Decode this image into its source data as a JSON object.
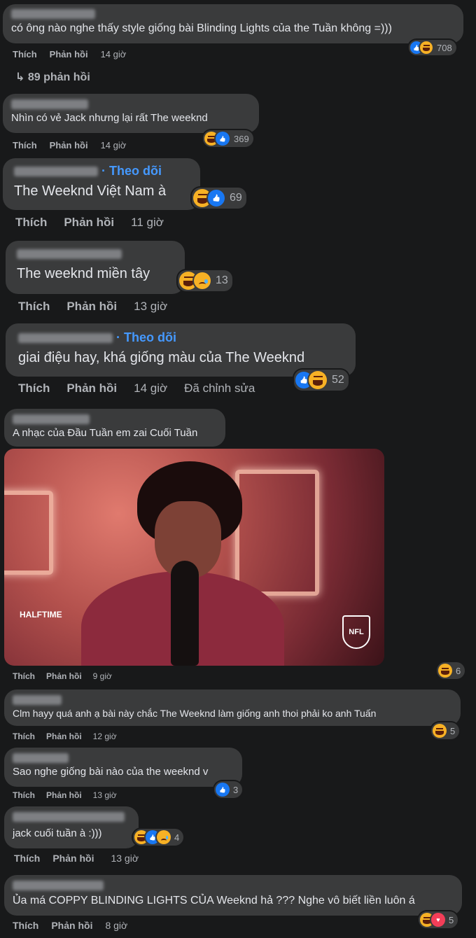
{
  "actions": {
    "like": "Thích",
    "reply": "Phản hồi",
    "edited": "Đã chỉnh sửa"
  },
  "follow_label": "· Theo dõi",
  "comments": [
    {
      "text": "có ông nào nghe thấy style giống bài Blinding Lights của the Tuần không =)))",
      "time": "14 giờ",
      "react_count": "708",
      "replies_label": "89 phản hồi"
    },
    {
      "text": "Nhìn có vẻ Jack nhưng lại rất The weeknd",
      "time": "14 giờ",
      "react_count": "369"
    },
    {
      "text": "The Weeknd Việt Nam à",
      "time": "11 giờ",
      "react_count": "69"
    },
    {
      "text": "The weeknd miền tây",
      "time": "13 giờ",
      "react_count": "13"
    },
    {
      "text": "giai điệu hay, khá giống màu của The Weeknd",
      "time": "14 giờ",
      "react_count": "52"
    },
    {
      "text": "A nhạc của Đầu Tuần em zai Cuối Tuần",
      "time": "9 giờ",
      "react_count": "6"
    },
    {
      "text": "Clm hayy quá anh ạ bài này chắc The Weeknd làm giống anh thoi phải ko anh Tuấn",
      "time": "12 giờ",
      "react_count": "5"
    },
    {
      "text": "Sao nghe giống bài nào của the weeknd v",
      "time": "13 giờ",
      "react_count": "3"
    },
    {
      "text": "jack cuối tuần à :)))",
      "time": "13 giờ",
      "react_count": "4"
    },
    {
      "text": "Ủa má COPPY BLINDING LIGHTS CỦA Weeknd hả ??? Nghe vô biết liền luôn á",
      "time": "8 giờ",
      "react_count": "5"
    }
  ],
  "gif": {
    "logo_left": "HALFTIME",
    "logo_right": "NFL"
  },
  "colors": {
    "background": "#18191a",
    "bubble": "#3a3b3c",
    "link": "#4599ff",
    "muted": "#b0b3b8"
  }
}
